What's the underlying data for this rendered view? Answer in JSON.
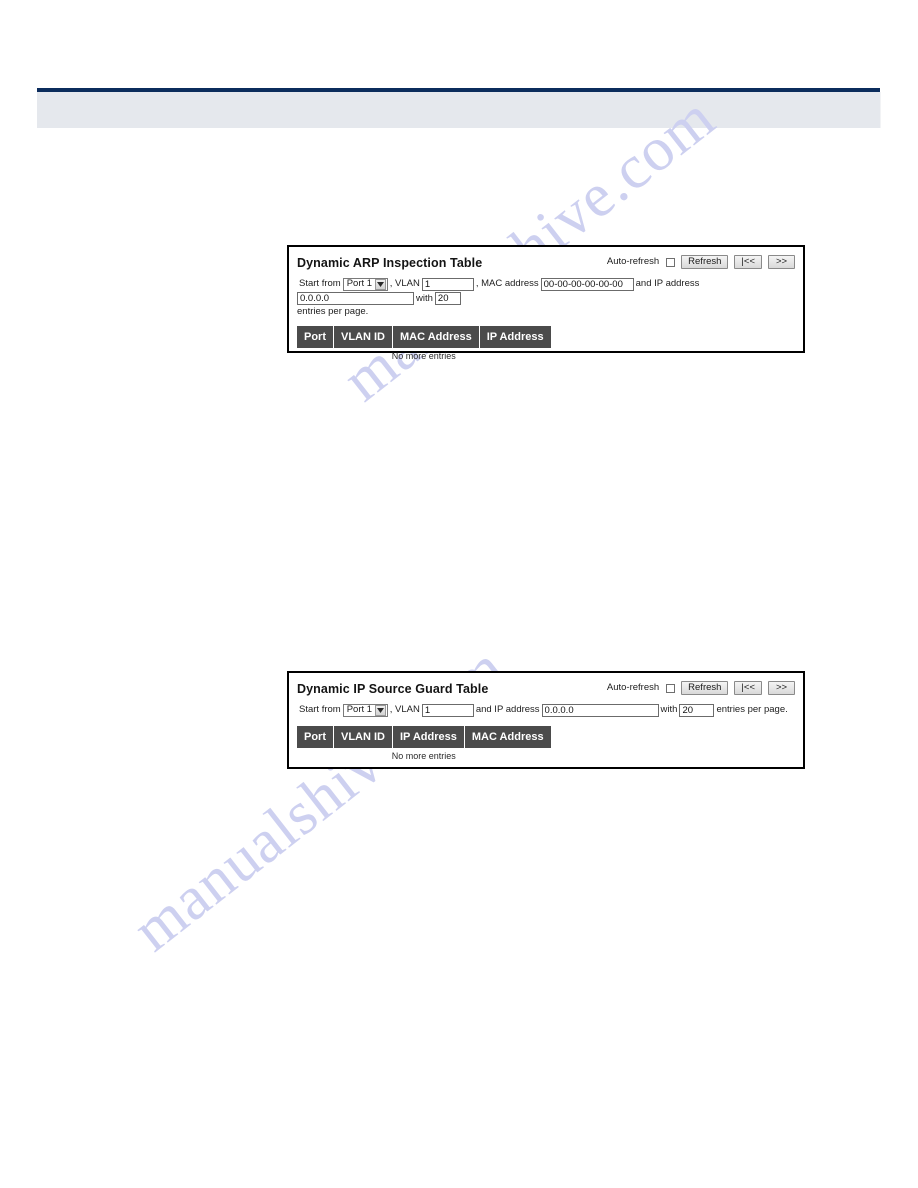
{
  "page": {
    "header_title": "",
    "watermarks": [
      "manualshive.com",
      "manualshive.com"
    ]
  },
  "panels": [
    {
      "id": "arp",
      "title": "Dynamic ARP Inspection Table",
      "controls": {
        "autorefresh_label": "Auto-refresh",
        "autorefresh_checked": false,
        "refresh_label": "Refresh",
        "first_label": "|<<",
        "next_label": ">>"
      },
      "filter": {
        "start_from_label": "Start from",
        "port_value": "Port 1",
        "vlan_label": ", VLAN",
        "vlan_value": "1",
        "mac_label": ", MAC address",
        "mac_value": "00-00-00-00-00-00",
        "ip_label": "and IP address",
        "ip_value": "0.0.0.0",
        "with_label": "with",
        "entries_value": "20",
        "entries_suffix": "entries per page."
      },
      "table": {
        "columns": [
          "Port",
          "VLAN ID",
          "MAC Address",
          "IP Address"
        ],
        "rows": [],
        "empty_text": "No more entries"
      }
    },
    {
      "id": "ipsg",
      "title": "Dynamic IP Source Guard Table",
      "controls": {
        "autorefresh_label": "Auto-refresh",
        "autorefresh_checked": false,
        "refresh_label": "Refresh",
        "first_label": "|<<",
        "next_label": ">>"
      },
      "filter": {
        "start_from_label": "Start from",
        "port_value": "Port 1",
        "vlan_label": ", VLAN",
        "vlan_value": "1",
        "ip_label": "and IP address",
        "ip_value": "0.0.0.0",
        "with_label": "with",
        "entries_value": "20",
        "entries_suffix": "entries per page."
      },
      "table": {
        "columns": [
          "Port",
          "VLAN ID",
          "IP Address",
          "MAC Address"
        ],
        "rows": [],
        "empty_text": "No more entries"
      }
    }
  ],
  "colors": {
    "header_rule": "#0b2c5c",
    "header_band": "#e5e8ed",
    "table_header_bg": "#4b4b4b",
    "watermark": "#cdd0f0",
    "panel_border": "#000000"
  }
}
